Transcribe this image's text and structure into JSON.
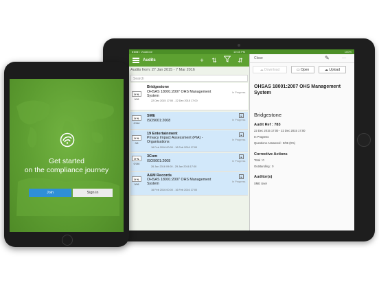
{
  "status_bar": {
    "carrier": "●●●●○ Vodafone",
    "time": "10:45 PM",
    "battery": "100%"
  },
  "audits_app": {
    "title": "Audits",
    "date_range": "Audits from: 27 Jan 2015 - 7 Mar 2016",
    "search_placeholder": "Search",
    "rows": [
      {
        "pct": "0 %",
        "questions": "0/96",
        "title": "Bridgestone",
        "subtitle": "OHSAS 18001:2007 OHS Management System",
        "dates": "22 Dec 2015 17:00 - 22 Dec 2015 17:00",
        "status": "In Progress",
        "locked": false
      },
      {
        "pct": "0 %",
        "questions": "0/146",
        "title": "SME",
        "subtitle": "ISO9001:2008",
        "dates": "",
        "status": "In Progress",
        "locked": true
      },
      {
        "pct": "0 %",
        "questions": "0/6",
        "title": "19 Entertainment",
        "subtitle": "Privacy Impact Assessment (PIA) - Organisations",
        "dates": "16 Feb 2016 00:00 - 16 Feb 2016 17:00",
        "status": "In Progress",
        "locked": true
      },
      {
        "pct": "0 %",
        "questions": "0/146",
        "title": "3Com",
        "subtitle": "ISO9001:2008",
        "dates": "26 Jan 2016 09:00 - 29 Jan 2016 17:00",
        "status": "In Progress",
        "locked": true
      },
      {
        "pct": "0 %",
        "questions": "0/96",
        "title": "A&M Records",
        "subtitle": "OHSAS 18001:2007 OHS Management System",
        "dates": "16 Feb 2016 00:00 - 16 Feb 2016 17:00",
        "status": "In Progress",
        "locked": true
      }
    ]
  },
  "detail": {
    "close_label": "Close",
    "more_icon": "···",
    "download_label": "Download",
    "open_label": "Open",
    "upload_label": "Upload",
    "standard": "OHSAS 18001:2007 OHS Management System",
    "company": "Bridgestone",
    "audit_ref": "Audit Ref : 783",
    "dates": "22 Dec 2015 17:00 - 22 Dec 2015 17:00",
    "status": "In Progress",
    "answered": "Questions Answered : 0/96 (0%)",
    "ca_title": "Corrective Actions",
    "ca_total": "Total : 0",
    "ca_outstanding": "Outstanding : 0",
    "auditors_title": "Auditor(s)",
    "auditor": "SME User"
  },
  "welcome": {
    "headline_line1": "Get started",
    "headline_line2": "on the compliance journey",
    "join_label": "Join",
    "signin_label": "Sign in"
  },
  "colors": {
    "brand_green": "#5da131",
    "row_blue": "#d2e8fa",
    "join_blue": "#2f8fd8"
  }
}
